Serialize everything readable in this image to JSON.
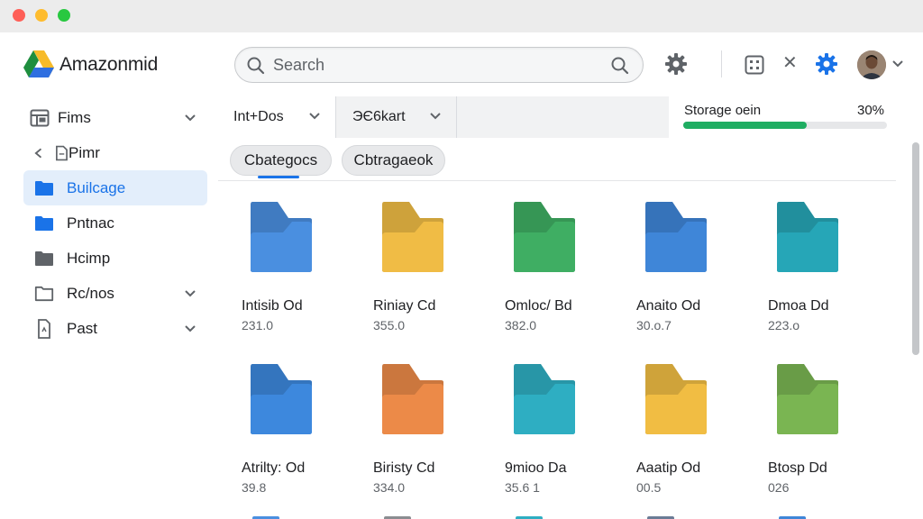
{
  "header": {
    "app_title": "Amazonmid",
    "logo_icon": "drive-triangle-icon",
    "search": {
      "placeholder": "Search",
      "value": ""
    },
    "icons": [
      "search-icon",
      "settings-gear-icon",
      "apps-grid-icon",
      "close-icon",
      "settings-gear-blue-icon",
      "avatar",
      "chevron-down-icon"
    ]
  },
  "sidebar": {
    "items": [
      {
        "label": "Fims",
        "icon": "grid-folder-icon",
        "chevron": true,
        "active": false
      },
      {
        "label": "Pimr",
        "icon": "back-file-icon",
        "chevron": false,
        "active": false
      },
      {
        "label": "Builcage",
        "icon": "folder-icon",
        "chevron": false,
        "active": true
      },
      {
        "label": "Pntnac",
        "icon": "folder-icon",
        "chevron": false,
        "active": false
      },
      {
        "label": "Hcimp",
        "icon": "folder-icon",
        "chevron": false,
        "active": false
      },
      {
        "label": "Rc/nos",
        "icon": "folder-outline-icon",
        "chevron": true,
        "active": false
      },
      {
        "label": "Past",
        "icon": "document-icon",
        "chevron": true,
        "active": false
      }
    ]
  },
  "tabs": [
    {
      "label": "Int+Dos"
    },
    {
      "label": "ЭЄ6kart"
    }
  ],
  "storage": {
    "label": "Storage oein",
    "percent_text": "30%",
    "percent": 30
  },
  "chips": [
    {
      "label": "Cbategocs"
    },
    {
      "label": "Cbtragaeok"
    }
  ],
  "files": [
    {
      "name": "Intisib Od",
      "size": "231.0",
      "color": "#4a8fe0"
    },
    {
      "name": "Riniay Cd",
      "size": "355.0",
      "color": "#f0bc45"
    },
    {
      "name": "Omloc/ Bd",
      "size": "382.0",
      "color": "#3fae63"
    },
    {
      "name": "Anaito Od",
      "size": "30.o.7",
      "color": "#3f86d8"
    },
    {
      "name": "Dmoa Dd",
      "size": "223.o",
      "color": "#26a6b7"
    },
    {
      "name": "Atrilty: Od",
      "size": "39.8",
      "color": "#3d88dd"
    },
    {
      "name": "Biristy Cd",
      "size": "334.0",
      "color": "#ec8a48"
    },
    {
      "name": "9mioo Da",
      "size": "35.6 1",
      "color": "#2eaec2"
    },
    {
      "name": "Aaatip Od",
      "size": "00.5",
      "color": "#f1bd43"
    },
    {
      "name": "Btosp Dd",
      "size": "026",
      "color": "#7ab552"
    }
  ],
  "colors": {
    "accent": "#1a73e8",
    "active_bg": "#e3eefb",
    "storage_fill": "#1fad62"
  }
}
